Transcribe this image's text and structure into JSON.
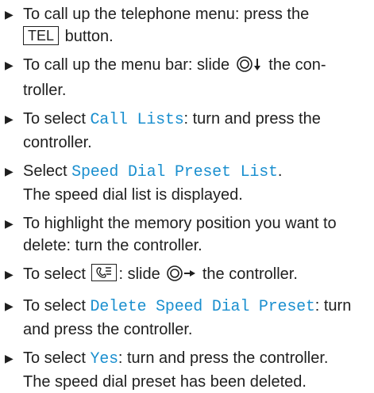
{
  "steps": [
    {
      "before": "To call up the telephone menu: press the",
      "key": "TEL",
      "after": " button."
    },
    {
      "before": "To call up the menu bar: slide ",
      "after": " the con-troller."
    },
    {
      "before": "To select ",
      "ui": "Call Lists",
      "after": ": turn and press the controller."
    },
    {
      "before": "Select ",
      "ui": "Speed Dial Preset List",
      "after": ".",
      "result": "The speed dial list is displayed."
    },
    {
      "before": "To highlight the memory position you want to delete: turn the controller."
    },
    {
      "before": "To select ",
      "mid": ": slide ",
      "after": " the controller."
    },
    {
      "before": "To select ",
      "ui": "Delete Speed Dial Preset",
      "after": ": turn and press the controller."
    },
    {
      "before": "To select ",
      "ui": "Yes",
      "after": ": turn and press the controller.",
      "result": "The speed dial preset has been deleted."
    }
  ],
  "icons": {
    "bullet": "triangle-right-icon",
    "controller_down": "controller-slide-down-icon",
    "controller_right": "controller-slide-right-icon",
    "menu_key": "phone-menu-key-icon"
  },
  "colors": {
    "ui_text": "#1a8fcf",
    "body_text": "#1f1f1f"
  }
}
